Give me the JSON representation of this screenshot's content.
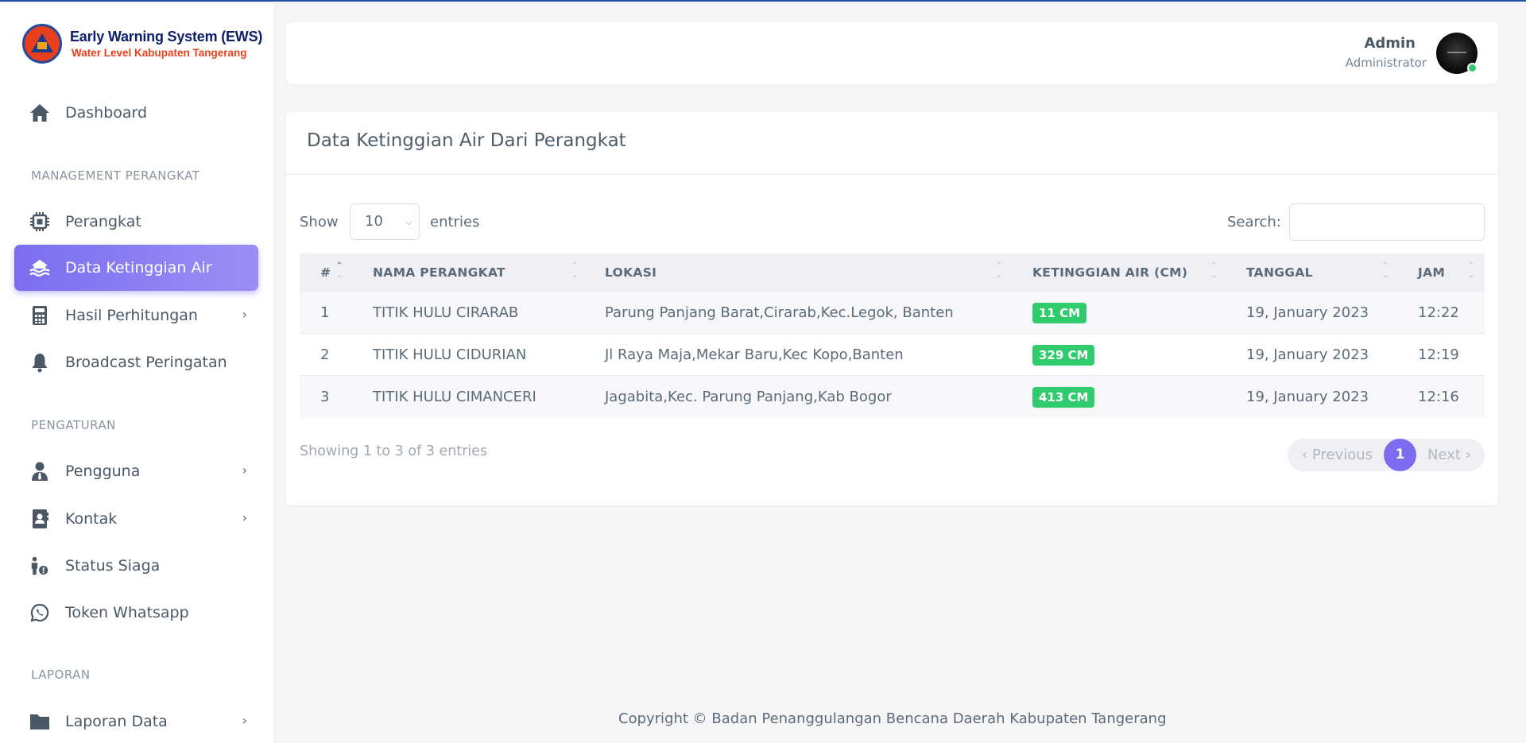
{
  "brand": {
    "title": "Early Warning System (EWS)",
    "subtitle": "Water Level Kabupaten Tangerang"
  },
  "sidebar": {
    "dashboard": "Dashboard",
    "section_management": "MANAGEMENT PERANGKAT",
    "perangkat": "Perangkat",
    "data_ketinggian": "Data Ketinggian Air",
    "hasil_perhitungan": "Hasil Perhitungan",
    "broadcast": "Broadcast Peringatan",
    "section_pengaturan": "PENGATURAN",
    "pengguna": "Pengguna",
    "kontak": "Kontak",
    "status_siaga": "Status Siaga",
    "token_whatsapp": "Token Whatsapp",
    "section_laporan": "LAPORAN",
    "laporan_data": "Laporan Data"
  },
  "user": {
    "name": "Admin",
    "role": "Administrator"
  },
  "card": {
    "title": "Data Ketinggian Air Dari Perangkat",
    "show_label": "Show",
    "page_size": "10",
    "entries_label": "entries",
    "search_label": "Search:",
    "search_value": ""
  },
  "table": {
    "headers": {
      "no": "#",
      "nama": "NAMA PERANGKAT",
      "lokasi": "LOKASI",
      "ketinggian": "KETINGGIAN AIR (CM)",
      "tanggal": "TANGGAL",
      "jam": "JAM"
    },
    "rows": [
      {
        "no": "1",
        "nama": "TITIK HULU CIRARAB",
        "lokasi": "Parung Panjang Barat,Cirarab,Kec.Legok, Banten",
        "ketinggian": "11 CM",
        "tanggal": "19, January 2023",
        "jam": "12:22"
      },
      {
        "no": "2",
        "nama": "TITIK HULU CIDURIAN",
        "lokasi": "Jl Raya Maja,Mekar Baru,Kec Kopo,Banten",
        "ketinggian": "329 CM",
        "tanggal": "19, January 2023",
        "jam": "12:19"
      },
      {
        "no": "3",
        "nama": "TITIK HULU CIMANCERI",
        "lokasi": "Jagabita,Kec. Parung Panjang,Kab Bogor",
        "ketinggian": "413 CM",
        "tanggal": "19, January 2023",
        "jam": "12:16"
      }
    ]
  },
  "pagination": {
    "info": "Showing 1 to 3 of 3 entries",
    "previous": "Previous",
    "current": "1",
    "next": "Next"
  },
  "footer": {
    "copyright": "Copyright © Badan Penanggulangan Bencana Daerah Kabupaten Tangerang"
  },
  "colors": {
    "accent": "#7c6df0",
    "badge_green": "#2fcb6c",
    "top_border": "#1f4fa8"
  }
}
